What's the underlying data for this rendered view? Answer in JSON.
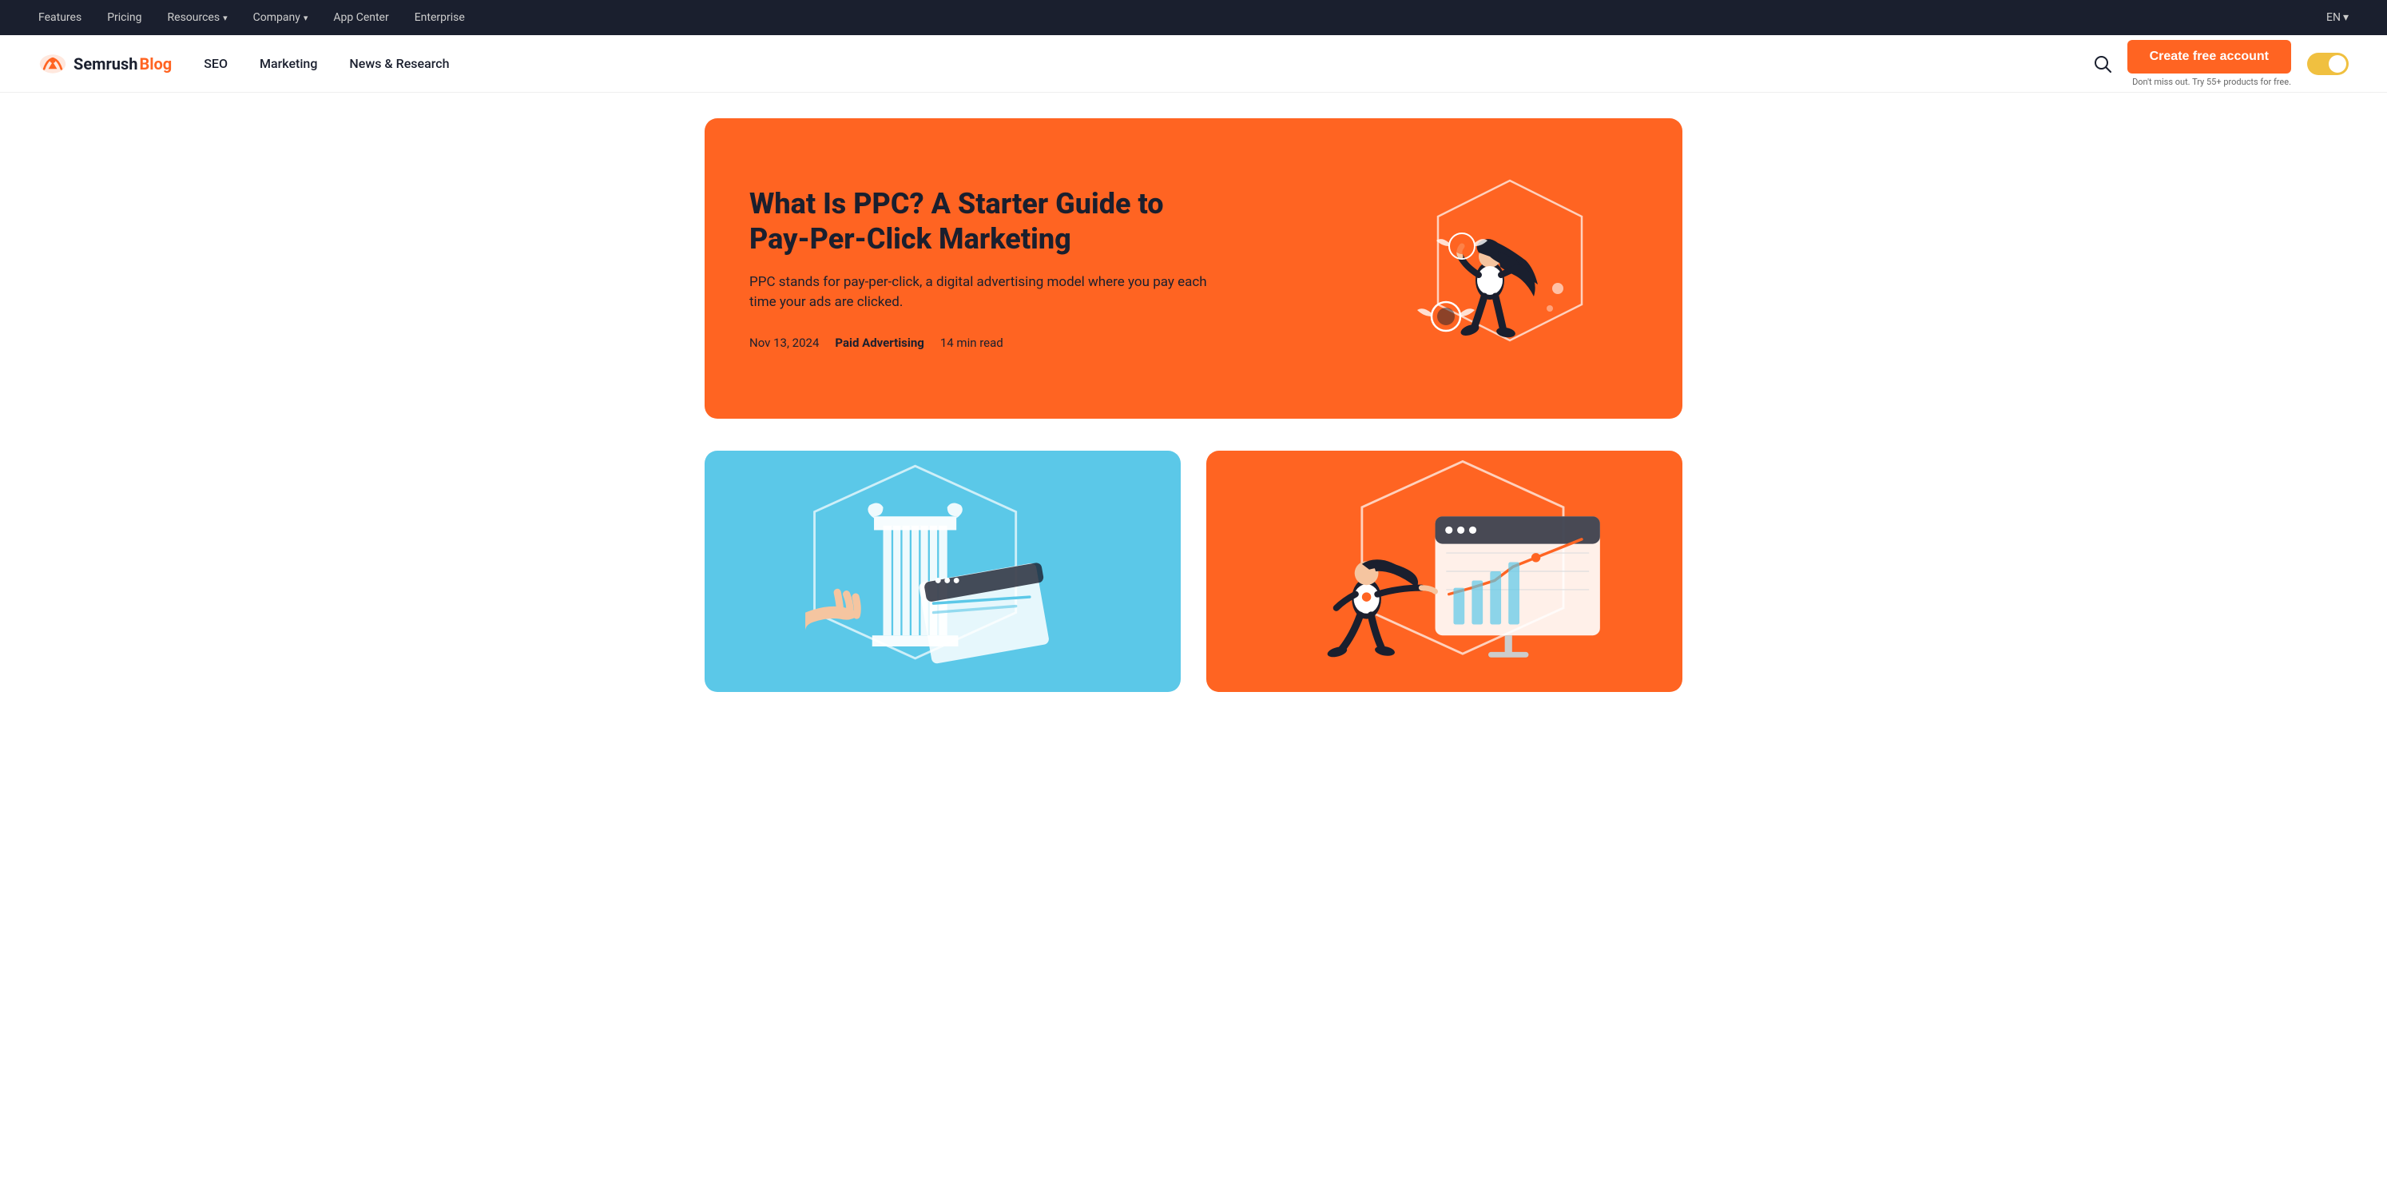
{
  "topNav": {
    "items": [
      {
        "label": "Features",
        "hasDropdown": false
      },
      {
        "label": "Pricing",
        "hasDropdown": false
      },
      {
        "label": "Resources",
        "hasDropdown": true
      },
      {
        "label": "Company",
        "hasDropdown": true
      },
      {
        "label": "App Center",
        "hasDropdown": false
      },
      {
        "label": "Enterprise",
        "hasDropdown": false
      }
    ],
    "lang": "EN",
    "langHasDropdown": true
  },
  "secondaryNav": {
    "logoText": "Semrush",
    "blogLabel": "Blog",
    "navItems": [
      {
        "label": "SEO"
      },
      {
        "label": "Marketing"
      },
      {
        "label": "News & Research"
      }
    ],
    "ctaButton": "Create free account",
    "ctaSubtitle": "Don't miss out. Try 55+ products for free."
  },
  "hero": {
    "title": "What Is PPC? A Starter Guide to Pay-Per-Click Marketing",
    "description": "PPC stands for pay-per-click, a digital advertising model where you pay each time your ads are clicked.",
    "date": "Nov 13, 2024",
    "tag": "Paid Advertising",
    "readTime": "14 min read",
    "bgColor": "#ff6422"
  },
  "bottomCards": [
    {
      "bgColor": "#5bc8e8",
      "id": "card-blue"
    },
    {
      "bgColor": "#ff6422",
      "id": "card-orange"
    }
  ],
  "colors": {
    "accent": "#ff6422",
    "dark": "#1a1f2e",
    "navBg": "#1a1f2e",
    "toggleBg": "#f0c040"
  }
}
